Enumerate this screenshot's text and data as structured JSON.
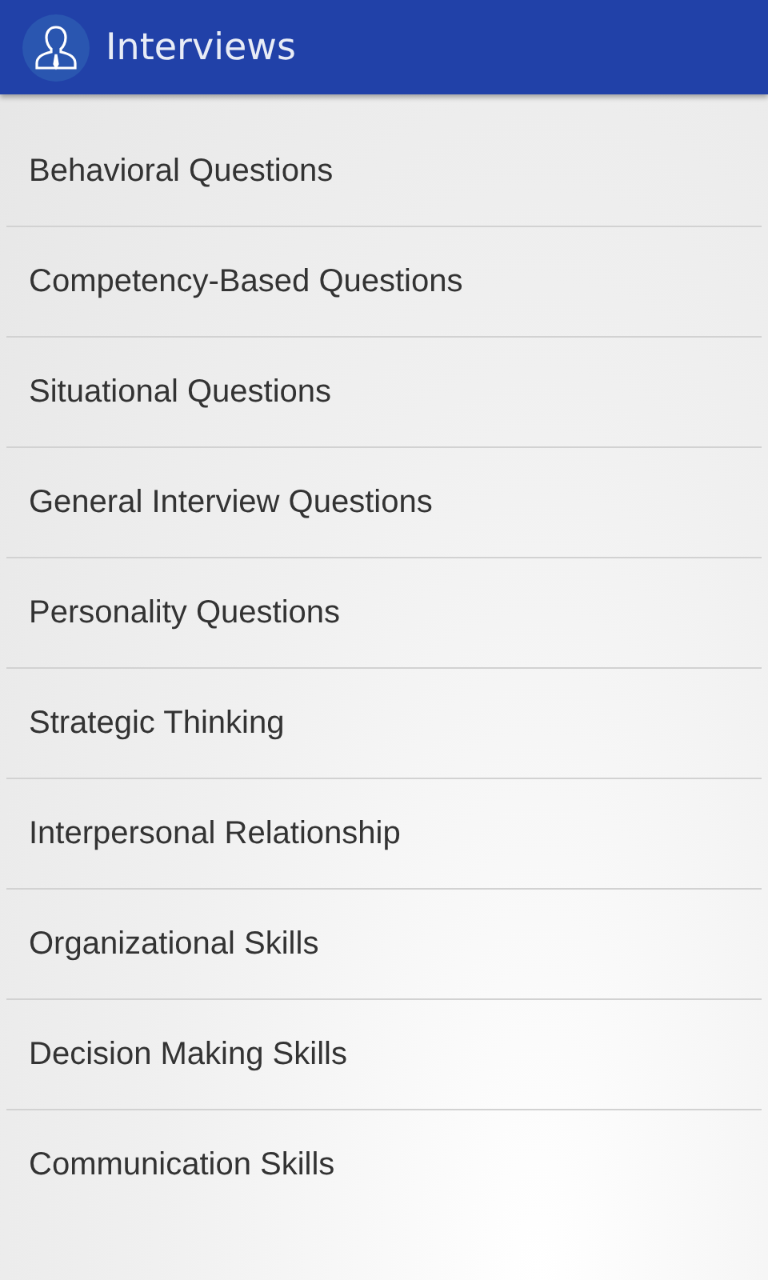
{
  "app_bar": {
    "title": "Interviews"
  },
  "items": [
    {
      "label": "Behavioral Questions"
    },
    {
      "label": "Competency-Based Questions"
    },
    {
      "label": "Situational Questions"
    },
    {
      "label": "General Interview Questions"
    },
    {
      "label": "Personality Questions"
    },
    {
      "label": "Strategic Thinking"
    },
    {
      "label": "Interpersonal Relationship"
    },
    {
      "label": "Organizational Skills"
    },
    {
      "label": "Decision Making Skills"
    },
    {
      "label": "Communication Skills"
    }
  ]
}
